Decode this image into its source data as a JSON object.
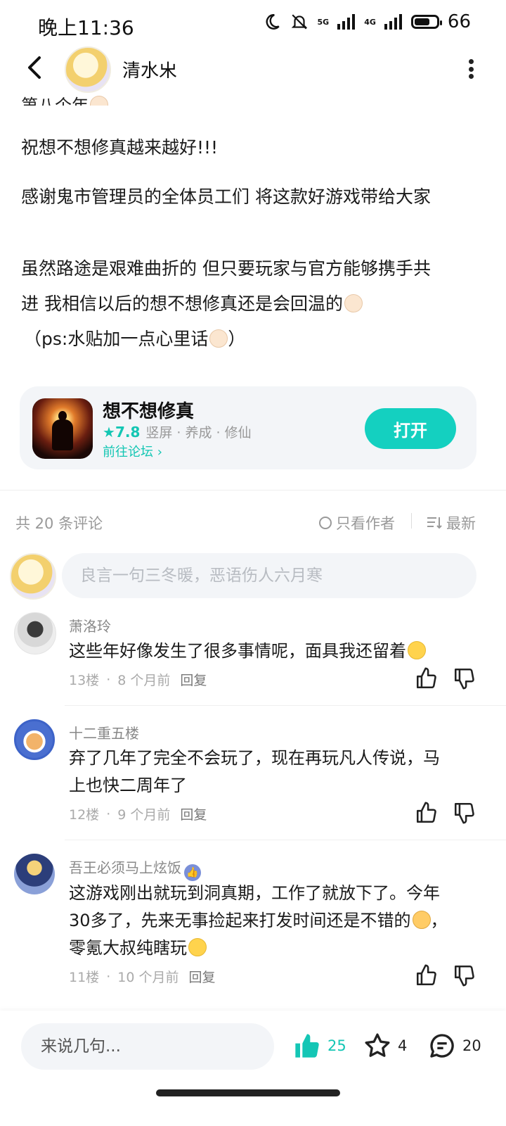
{
  "status_bar": {
    "time": "晚上11:36",
    "net1": "5G",
    "net2": "4G",
    "battery": "66"
  },
  "header": {
    "author": "清水𣎵"
  },
  "post": {
    "cut_line": "第八个年",
    "p1": "祝想不想修真越来越好!!!",
    "p2": "感谢鬼市管理员的全体员工们 将这款好游戏带给大家",
    "p3a": "虽然路途是艰难曲折的 但只要玩家与官方能够携手共",
    "p3b": "进 我相信以后的想不想修真还是会回温的",
    "p4": "（ps:水贴加一点心里话",
    "p4_end": "）"
  },
  "game_card": {
    "name": "想不想修真",
    "score": "7.8",
    "tags": "竖屏 · 养成 · 修仙",
    "forum_link": "前往论坛",
    "open_label": "打开"
  },
  "comments_header": {
    "count": "共 20 条评论",
    "only_author": "只看作者",
    "sort": "最新"
  },
  "comment_input": {
    "placeholder": "良言一句三冬暖，恶语伤人六月寒"
  },
  "comments": [
    {
      "user": "萧洛玲",
      "text": "这些年好像发生了很多事情呢，面具我还留着",
      "floor": "13楼",
      "time": "8 个月前",
      "reply": "回复"
    },
    {
      "user": "十二重五楼",
      "text1": "弃了几年了完全不会玩了，现在再玩凡人传说，马",
      "text2": "上也快二周年了",
      "floor": "12楼",
      "time": "9 个月前",
      "reply": "回复"
    },
    {
      "user": "吾王必须马上炫饭",
      "text1": "这游戏刚出就玩到洞真期，工作了就放下了。今年",
      "text2": "30多了，先来无事捡起来打发时间还是不错的",
      "text2_end": "，",
      "text3": "零氪大叔纯瞎玩",
      "floor": "11楼",
      "time": "10 个月前",
      "reply": "回复"
    }
  ],
  "bottom_bar": {
    "placeholder": "来说几句...",
    "likes": "25",
    "favorites": "4",
    "comments": "20"
  },
  "colors": {
    "accent": "#14d0c0",
    "text": "#1a1a1a",
    "muted": "#999999"
  }
}
